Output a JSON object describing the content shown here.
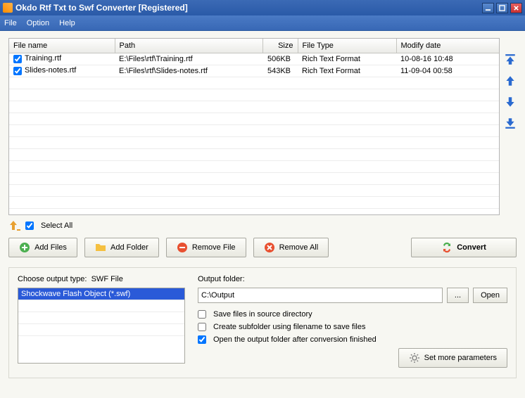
{
  "window": {
    "title": "Okdo Rtf Txt to Swf Converter [Registered]"
  },
  "menu": {
    "file": "File",
    "option": "Option",
    "help": "Help"
  },
  "columns": {
    "name": "File name",
    "path": "Path",
    "size": "Size",
    "type": "File Type",
    "date": "Modify date"
  },
  "files": [
    {
      "name": "Training.rtf",
      "path": "E:\\Files\\rtf\\Training.rtf",
      "size": "506KB",
      "type": "Rich Text Format",
      "date": "10-08-16 10:48"
    },
    {
      "name": "Slides-notes.rtf",
      "path": "E:\\Files\\rtf\\Slides-notes.rtf",
      "size": "543KB",
      "type": "Rich Text Format",
      "date": "11-09-04 00:58"
    }
  ],
  "selectAll": "Select All",
  "buttons": {
    "addFiles": "Add Files",
    "addFolder": "Add Folder",
    "removeFile": "Remove File",
    "removeAll": "Remove All",
    "convert": "Convert"
  },
  "output": {
    "typeLabel": "Choose output type:",
    "typeValue": "SWF File",
    "typeOption": "Shockwave Flash Object (*.swf)",
    "folderLabel": "Output folder:",
    "folderValue": "C:\\Output",
    "browse": "...",
    "open": "Open",
    "opt1": "Save files in source directory",
    "opt2": "Create subfolder using filename to save files",
    "opt3": "Open the output folder after conversion finished",
    "more": "Set more parameters"
  }
}
